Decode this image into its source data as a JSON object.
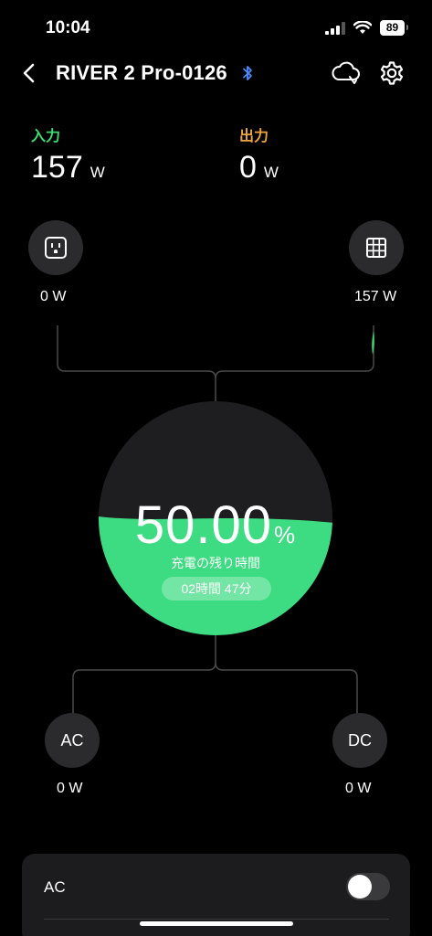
{
  "status_bar": {
    "time": "10:04",
    "battery": "89"
  },
  "header": {
    "title": "RIVER 2 Pro-0126"
  },
  "summary": {
    "input_label": "入力",
    "input_value": "157",
    "input_unit": "W",
    "output_label": "出力",
    "output_value": "0",
    "output_unit": "W"
  },
  "ports": {
    "ac_in": {
      "value": "0 W"
    },
    "solar_in": {
      "value": "157 W"
    },
    "ac_out": {
      "label": "AC",
      "value": "0 W"
    },
    "dc_out": {
      "label": "DC",
      "value": "0 W"
    }
  },
  "battery": {
    "percent": "50.00",
    "percent_symbol": "%",
    "level": 0.5,
    "sub_label": "充電の残り時間",
    "remaining": "02時間 47分"
  },
  "bottom_card": {
    "ac_label": "AC",
    "ac_enabled": false
  },
  "colors": {
    "input": "#3ddc73",
    "output": "#f0a43c",
    "battery_fill": "#3ddc82",
    "background": "#000000"
  }
}
